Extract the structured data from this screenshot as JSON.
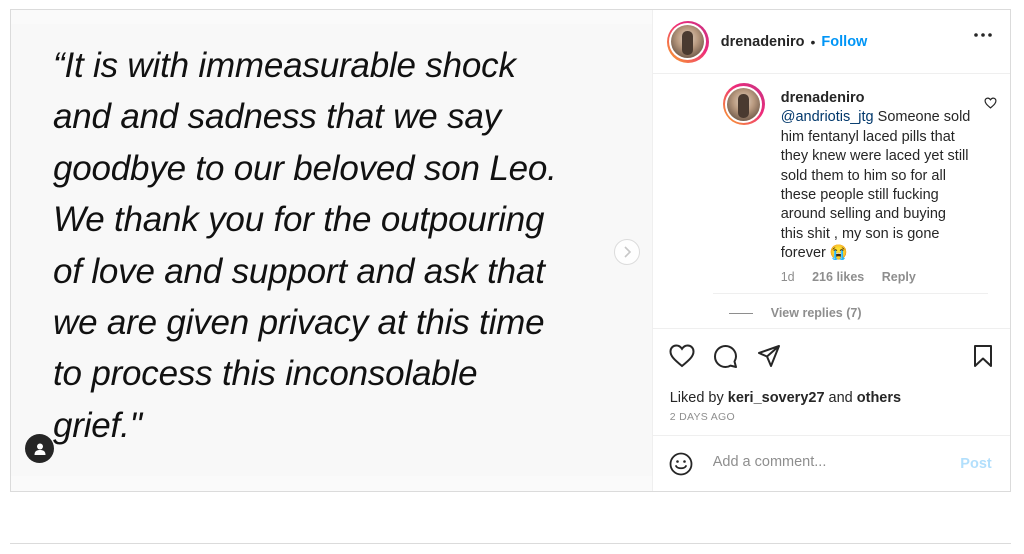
{
  "post": {
    "quote_lines": [
      "“It is with immeasurable shock",
      "and and sadness that we say",
      "goodbye to our beloved son Leo.",
      "We thank you for the outpouring",
      "of love and support and ask that",
      "we are given privacy at this time",
      "to process this inconsolable",
      "grief.\""
    ]
  },
  "header": {
    "username": "drenadeniro",
    "separator": "•",
    "follow_label": "Follow"
  },
  "comment": {
    "username": "drenadeniro",
    "mention": "@andriotis_jtg",
    "text": " Someone sold him fentanyl laced pills that they knew were laced yet still sold them to him so for all these people still fucking around selling and buying this shit , my son is gone forever 😭",
    "time": "1d",
    "likes": "216 likes",
    "reply_label": "Reply",
    "view_replies": "View replies (7)"
  },
  "likes": {
    "prefix": "Liked by ",
    "user": "keri_sovery27",
    "and": " and ",
    "others": "others"
  },
  "date": "2 DAYS AGO",
  "add_comment": {
    "placeholder": "Add a comment...",
    "post_label": "Post"
  },
  "icons": {
    "next": "chevron-right-icon",
    "tag": "user-tag-icon",
    "more": "more-horizontal-icon",
    "heart": "heart-icon",
    "comment": "comment-icon",
    "share": "share-icon",
    "save": "bookmark-icon",
    "emoji": "emoji-icon"
  },
  "colors": {
    "accent": "#0095f6",
    "post_disabled": "#b2dffc",
    "muted": "#8e8e8e",
    "mention": "#00376b"
  }
}
